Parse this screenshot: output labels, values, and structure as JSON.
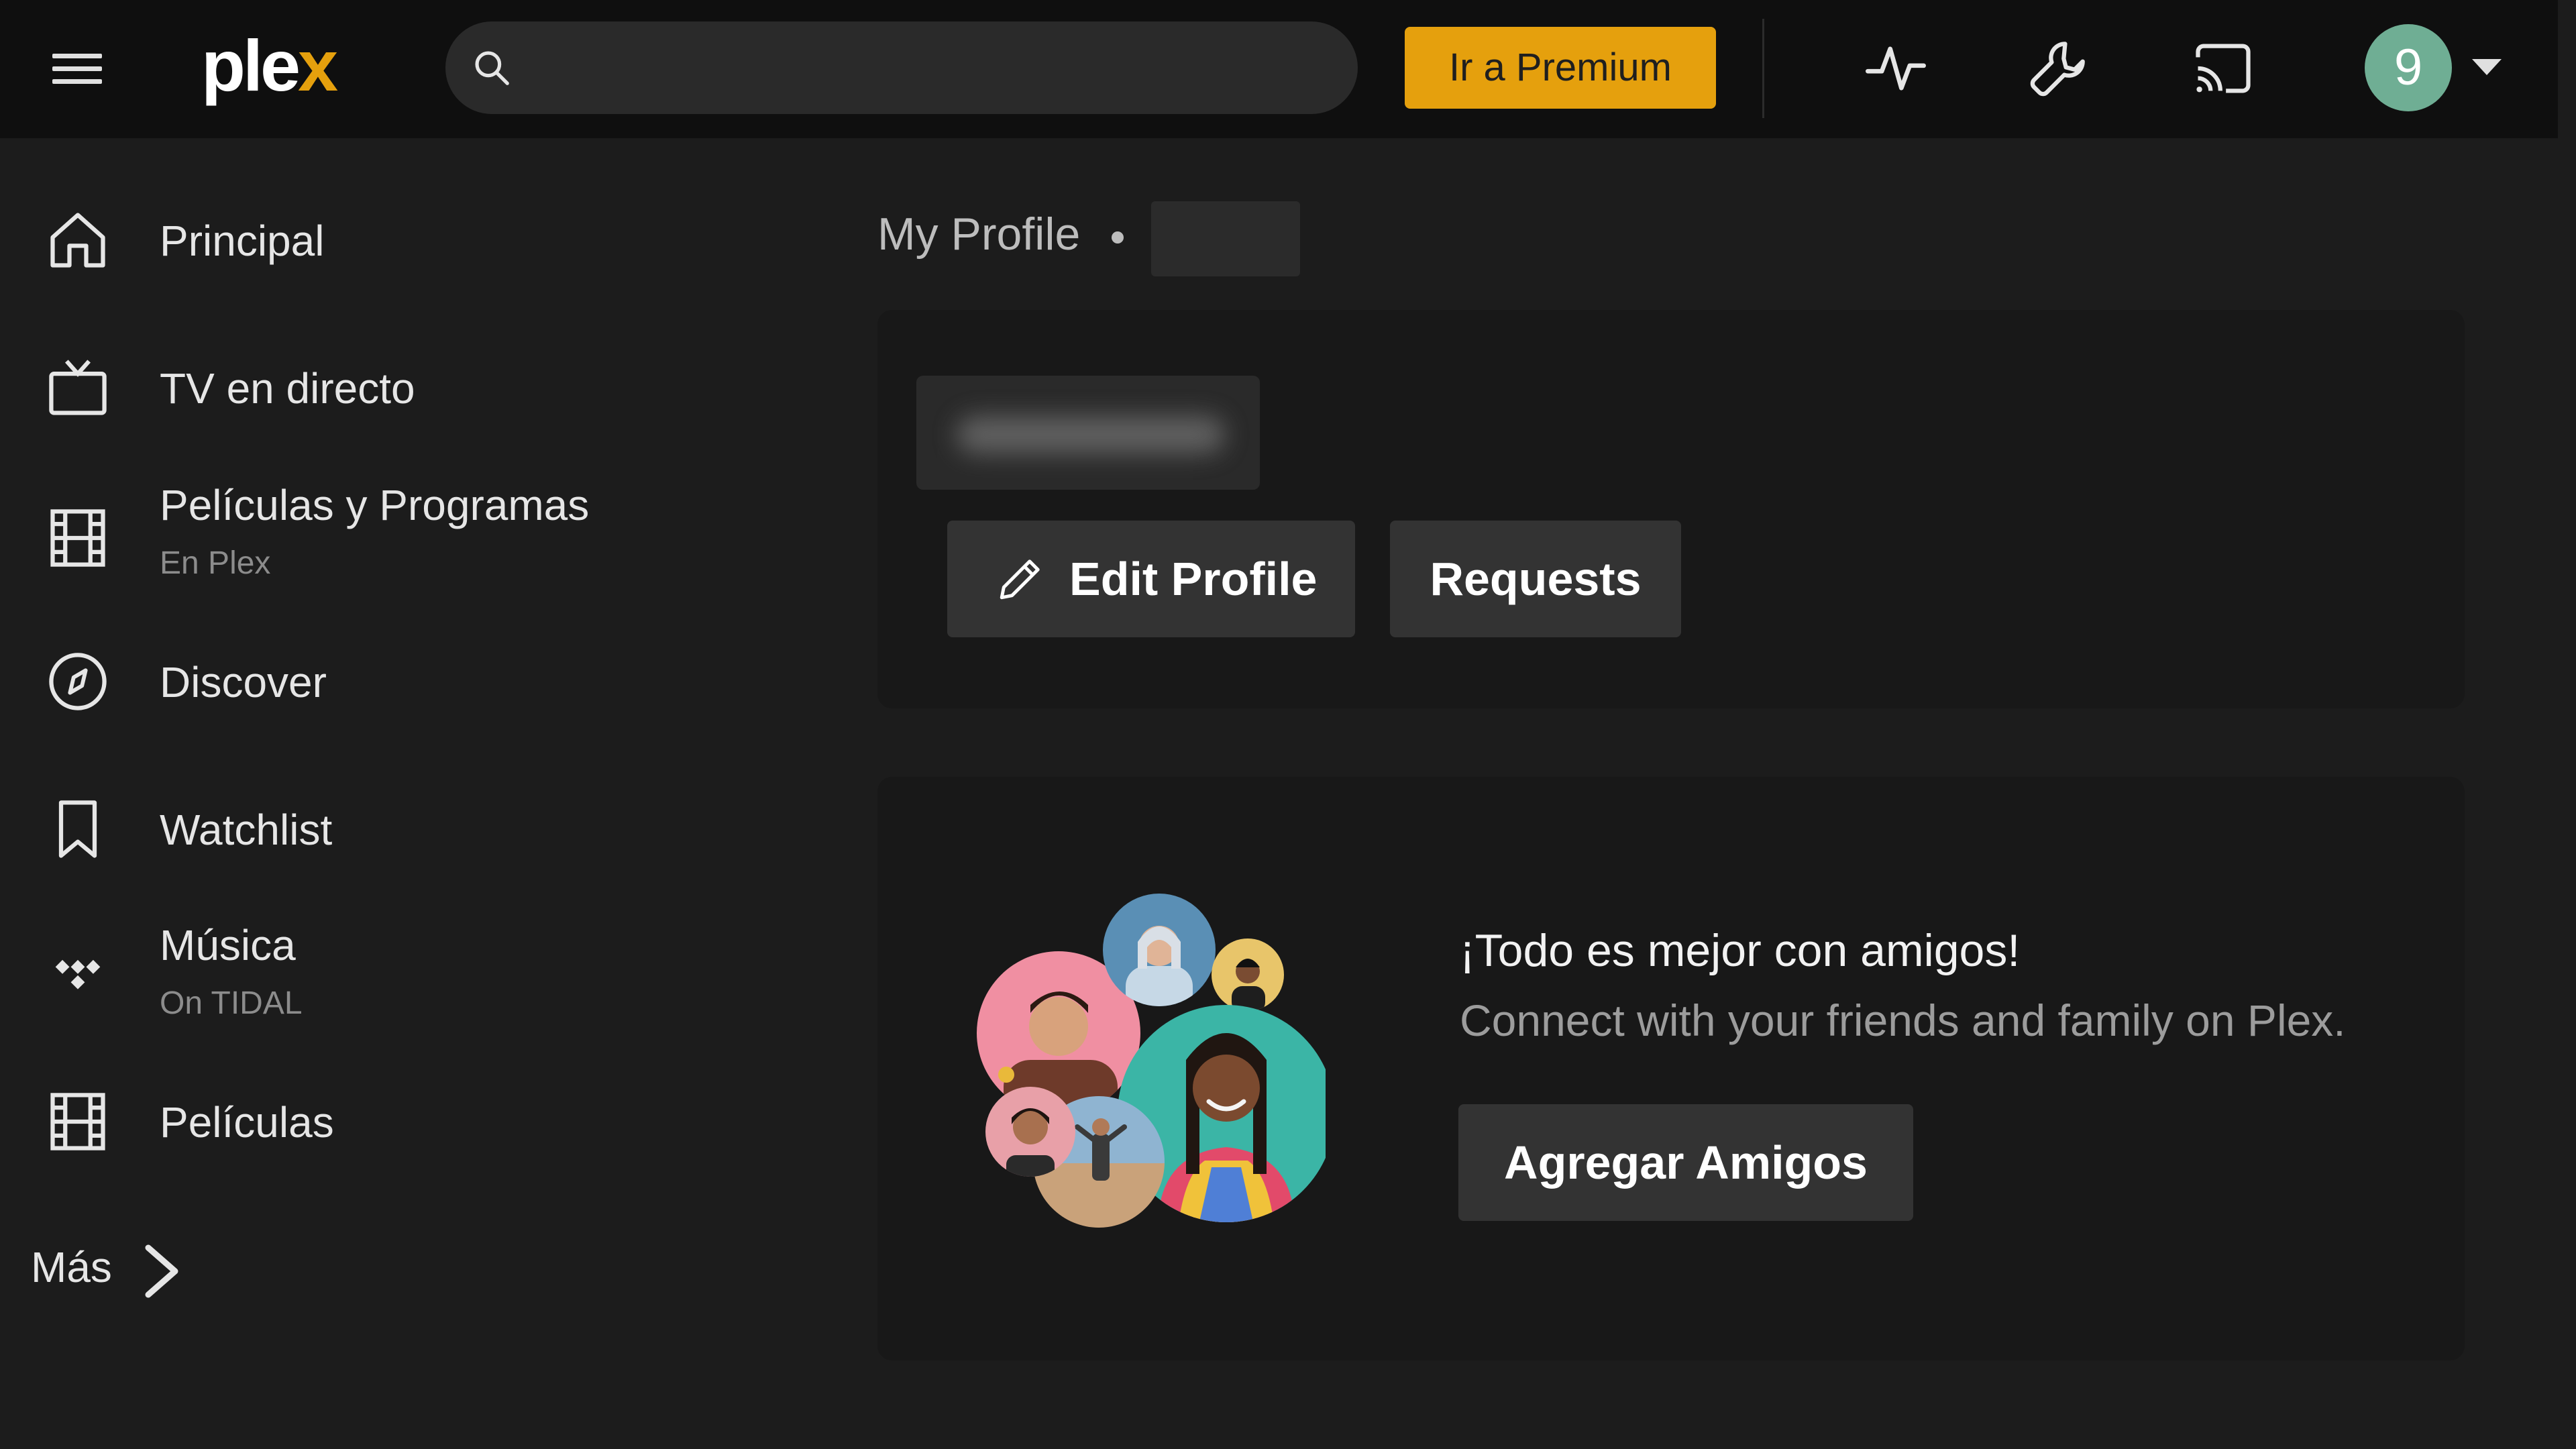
{
  "topbar": {
    "logo_main": "ple",
    "logo_accent": "x",
    "search": {
      "placeholder": "",
      "value": ""
    },
    "premium_label": "Ir a Premium",
    "avatar_initial": "9",
    "icons": [
      "menu-icon",
      "search-icon",
      "activity-icon",
      "wrench-icon",
      "cast-icon",
      "chevron-down-icon"
    ]
  },
  "sidebar": {
    "items": [
      {
        "label": "Principal",
        "sub": "",
        "icon": "home-icon"
      },
      {
        "label": "TV en directo",
        "sub": "",
        "icon": "tv-icon"
      },
      {
        "label": "Películas y Programas",
        "sub": "En Plex",
        "icon": "film-icon"
      },
      {
        "label": "Discover",
        "sub": "",
        "icon": "compass-icon"
      },
      {
        "label": "Watchlist",
        "sub": "",
        "icon": "bookmark-icon"
      },
      {
        "label": "Música",
        "sub": "On TIDAL",
        "icon": "tidal-icon"
      },
      {
        "label": "Películas",
        "sub": "",
        "icon": "film-icon"
      }
    ],
    "more_label": "Más"
  },
  "main": {
    "breadcrumb": {
      "title": "My Profile"
    },
    "profile": {
      "edit_label": "Edit Profile",
      "requests_label": "Requests"
    },
    "friends": {
      "title": "¡Todo es mejor con amigos!",
      "subtitle": "Connect with your friends and family on Plex.",
      "button_label": "Agregar Amigos"
    }
  },
  "colors": {
    "accent": "#e5a00d",
    "topbar_bg": "#0f0f0f",
    "page_bg": "#1c1c1c",
    "card_bg": "#181818",
    "button_bg": "#333333",
    "avatar_bg": "#6fae94"
  }
}
